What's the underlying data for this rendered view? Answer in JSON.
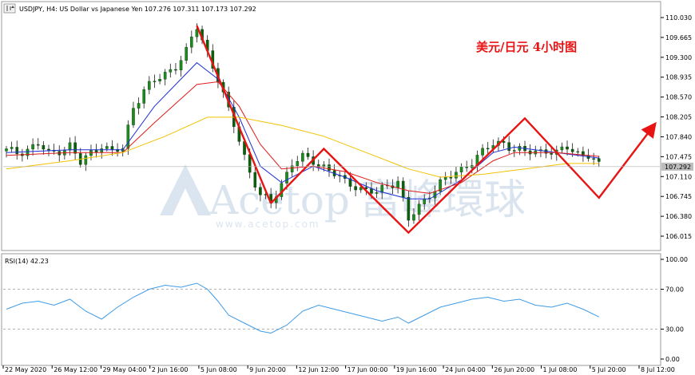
{
  "header": {
    "symbol_line": "USDJPY, H4:  US Dollar vs Japanese Yen  107.276 107.311 107.173 107.292",
    "annotation_cn": "美元/日元 4小时图"
  },
  "watermark": {
    "text_en": "Acetop",
    "text_cn": "富峰環球",
    "url": "www.acetop.com"
  },
  "colors": {
    "candle_up": "#1f8a1f",
    "candle_down": "#1f8a1f",
    "ma_fast": "#1d2fd6",
    "ma_mid": "#e01a1a",
    "ma_slow": "#f2c200",
    "zigzag": "#e81414",
    "rsi": "#3f9be6",
    "price_tag": "#bdbdbd"
  },
  "chart_data": [
    {
      "type": "candlestick",
      "title": "USDJPY, H4",
      "price_axis_labels": [
        "110.030",
        "109.665",
        "109.300",
        "108.935",
        "108.570",
        "108.205",
        "107.840",
        "107.475",
        "107.110",
        "106.745",
        "106.380",
        "106.015"
      ],
      "ylim": [
        105.82,
        110.18
      ],
      "current_price": "107.292",
      "time_axis_labels": [
        "22 May 2020",
        "26 May 12:00",
        "29 May 04:00",
        "2 Jun 16:00",
        "5 Jun 08:00",
        "9 Jun 20:00",
        "12 Jun 12:00",
        "17 Jun 00:00",
        "19 Jun 16:00",
        "24 Jun 04:00",
        "26 Jun 20:00",
        "1 Jul 08:00",
        "5 Jul 20:00",
        "8 Jul 12:00"
      ],
      "close_path": [
        [
          0,
          107.58
        ],
        [
          2,
          107.55
        ],
        [
          4,
          107.62
        ],
        [
          6,
          107.7
        ],
        [
          8,
          107.52
        ],
        [
          10,
          107.6
        ],
        [
          12,
          107.68
        ],
        [
          14,
          107.35
        ],
        [
          16,
          107.55
        ],
        [
          18,
          107.7
        ],
        [
          20,
          107.55
        ],
        [
          22,
          107.62
        ],
        [
          24,
          108.4
        ],
        [
          26,
          108.7
        ],
        [
          28,
          108.85
        ],
        [
          30,
          109.0
        ],
        [
          32,
          109.15
        ],
        [
          34,
          109.4
        ],
        [
          36,
          109.85
        ],
        [
          38,
          109.4
        ],
        [
          40,
          108.9
        ],
        [
          42,
          108.3
        ],
        [
          44,
          107.8
        ],
        [
          46,
          107.2
        ],
        [
          48,
          106.75
        ],
        [
          50,
          106.62
        ],
        [
          52,
          107.0
        ],
        [
          54,
          107.35
        ],
        [
          56,
          107.45
        ],
        [
          58,
          107.4
        ],
        [
          60,
          107.3
        ],
        [
          62,
          107.15
        ],
        [
          64,
          107.0
        ],
        [
          66,
          106.95
        ],
        [
          68,
          106.85
        ],
        [
          70,
          106.8
        ],
        [
          72,
          106.95
        ],
        [
          74,
          107.05
        ],
        [
          76,
          106.3
        ],
        [
          78,
          106.55
        ],
        [
          80,
          106.8
        ],
        [
          82,
          107.0
        ],
        [
          84,
          107.1
        ],
        [
          86,
          107.25
        ],
        [
          88,
          107.4
        ],
        [
          90,
          107.55
        ],
        [
          92,
          107.7
        ],
        [
          94,
          107.75
        ],
        [
          96,
          107.6
        ],
        [
          98,
          107.55
        ],
        [
          100,
          107.58
        ],
        [
          102,
          107.6
        ],
        [
          104,
          107.52
        ],
        [
          106,
          107.65
        ],
        [
          108,
          107.55
        ],
        [
          110,
          107.5
        ],
        [
          112,
          107.29
        ]
      ],
      "moving_averages": [
        {
          "name": "fast",
          "color_key": "ma_fast",
          "points": [
            [
              0,
              107.55
            ],
            [
              12,
              107.6
            ],
            [
              22,
              107.6
            ],
            [
              28,
              108.4
            ],
            [
              36,
              109.2
            ],
            [
              40,
              108.9
            ],
            [
              44,
              108.2
            ],
            [
              48,
              107.3
            ],
            [
              52,
              107.0
            ],
            [
              58,
              107.3
            ],
            [
              64,
              107.1
            ],
            [
              70,
              106.85
            ],
            [
              76,
              106.7
            ],
            [
              80,
              106.7
            ],
            [
              86,
              107.05
            ],
            [
              92,
              107.55
            ],
            [
              96,
              107.65
            ],
            [
              104,
              107.55
            ],
            [
              112,
              107.45
            ]
          ]
        },
        {
          "name": "mid",
          "color_key": "ma_mid",
          "points": [
            [
              0,
              107.5
            ],
            [
              12,
              107.55
            ],
            [
              22,
              107.55
            ],
            [
              28,
              108.1
            ],
            [
              36,
              108.8
            ],
            [
              40,
              108.85
            ],
            [
              44,
              108.4
            ],
            [
              48,
              107.7
            ],
            [
              52,
              107.25
            ],
            [
              58,
              107.3
            ],
            [
              64,
              107.2
            ],
            [
              70,
              107.0
            ],
            [
              76,
              106.85
            ],
            [
              80,
              106.8
            ],
            [
              86,
              107.0
            ],
            [
              92,
              107.4
            ],
            [
              96,
              107.55
            ],
            [
              104,
              107.55
            ],
            [
              112,
              107.48
            ]
          ]
        },
        {
          "name": "slow",
          "color_key": "ma_slow",
          "points": [
            [
              0,
              107.25
            ],
            [
              12,
              107.4
            ],
            [
              22,
              107.55
            ],
            [
              30,
              107.85
            ],
            [
              38,
              108.2
            ],
            [
              44,
              108.2
            ],
            [
              52,
              108.05
            ],
            [
              60,
              107.85
            ],
            [
              68,
              107.55
            ],
            [
              76,
              107.25
            ],
            [
              82,
              107.1
            ],
            [
              90,
              107.15
            ],
            [
              98,
              107.25
            ],
            [
              106,
              107.35
            ],
            [
              112,
              107.35
            ]
          ]
        }
      ],
      "zigzag": [
        [
          50,
          106.62
        ],
        [
          60,
          107.62
        ],
        [
          76,
          106.08
        ],
        [
          98,
          108.18
        ],
        [
          112,
          106.72
        ],
        [
          122,
          108.0
        ]
      ],
      "zigzag_second_leg": [
        [
          36,
          109.88
        ],
        [
          50,
          106.62
        ]
      ]
    },
    {
      "type": "line",
      "title": "RSI(14) 42.23",
      "axis_labels": [
        "100.00",
        "70.00",
        "30.00",
        "0.00"
      ],
      "ylim": [
        0,
        100
      ],
      "levels": [
        70,
        30
      ],
      "values": [
        [
          0,
          50
        ],
        [
          3,
          56
        ],
        [
          6,
          58
        ],
        [
          9,
          54
        ],
        [
          12,
          60
        ],
        [
          15,
          48
        ],
        [
          18,
          40
        ],
        [
          21,
          52
        ],
        [
          24,
          62
        ],
        [
          27,
          70
        ],
        [
          30,
          74
        ],
        [
          33,
          72
        ],
        [
          36,
          76
        ],
        [
          38,
          70
        ],
        [
          40,
          58
        ],
        [
          42,
          44
        ],
        [
          45,
          36
        ],
        [
          48,
          28
        ],
        [
          50,
          26
        ],
        [
          53,
          34
        ],
        [
          56,
          48
        ],
        [
          59,
          54
        ],
        [
          62,
          50
        ],
        [
          65,
          46
        ],
        [
          68,
          42
        ],
        [
          71,
          38
        ],
        [
          74,
          42
        ],
        [
          76,
          36
        ],
        [
          79,
          44
        ],
        [
          82,
          52
        ],
        [
          85,
          56
        ],
        [
          88,
          60
        ],
        [
          91,
          62
        ],
        [
          94,
          58
        ],
        [
          97,
          60
        ],
        [
          100,
          54
        ],
        [
          103,
          52
        ],
        [
          106,
          56
        ],
        [
          109,
          50
        ],
        [
          112,
          42.23
        ]
      ]
    }
  ]
}
